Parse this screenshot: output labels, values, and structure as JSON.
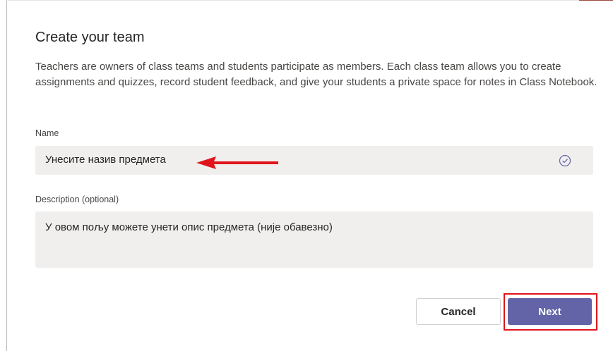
{
  "dialog": {
    "title": "Create your team",
    "description": "Teachers are owners of class teams and students participate as members. Each class team allows you to create assignments and quizzes, record student feedback, and give your students a private space for notes in Class Notebook."
  },
  "form": {
    "name_label": "Name",
    "name_value": "Унесите назив предмета",
    "description_label": "Description (optional)",
    "description_value": "У овом пољу можете унети опис предмета (није обавезно)"
  },
  "buttons": {
    "cancel_label": "Cancel",
    "next_label": "Next"
  },
  "annotations": {
    "arrow_color": "#e1141b",
    "highlight_color": "#e1141b"
  },
  "colors": {
    "primary": "#6264a7",
    "field_background": "#f0efee"
  },
  "icons": {
    "name_field_status": "check-circle-icon"
  }
}
